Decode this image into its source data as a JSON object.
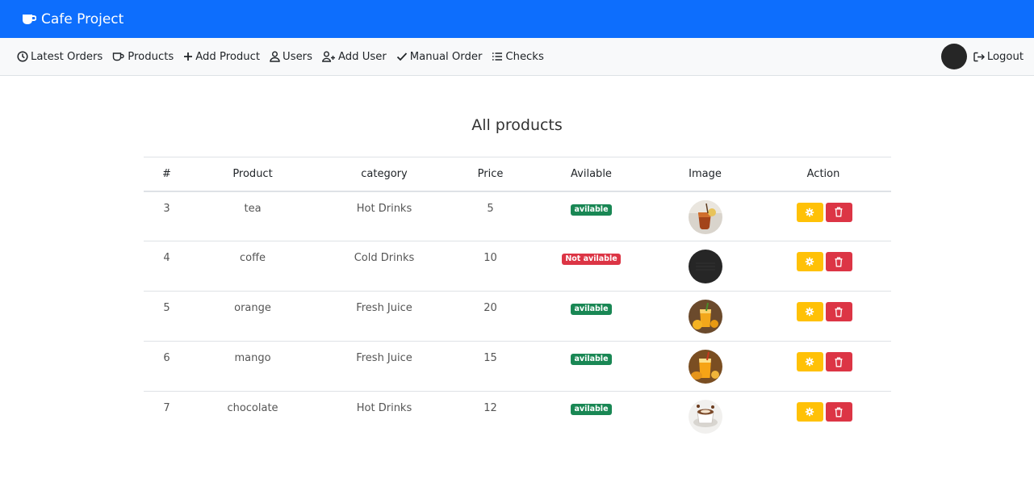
{
  "app": {
    "title": "Cafe Project"
  },
  "nav": {
    "links": [
      {
        "label": "Latest Orders",
        "icon": "clock-icon"
      },
      {
        "label": "Products",
        "icon": "cup-icon"
      },
      {
        "label": "Add Product",
        "icon": "plus-icon"
      },
      {
        "label": "Users",
        "icon": "user-icon"
      },
      {
        "label": "Add User",
        "icon": "user-plus-icon"
      },
      {
        "label": "Manual Order",
        "icon": "check-icon"
      },
      {
        "label": "Checks",
        "icon": "list-icon"
      }
    ],
    "logout_label": "Logout"
  },
  "page": {
    "title": "All products"
  },
  "table": {
    "headers": [
      "#",
      "Product",
      "category",
      "Price",
      "Avilable",
      "Image",
      "Action"
    ],
    "rows": [
      {
        "id": "3",
        "product": "tea",
        "category": "Hot Drinks",
        "price": "5",
        "status": "avilable",
        "available": true,
        "image": "tea-image"
      },
      {
        "id": "4",
        "product": "coffe",
        "category": "Cold Drinks",
        "price": "10",
        "status": "Not avilable",
        "available": false,
        "image": "coffee-image"
      },
      {
        "id": "5",
        "product": "orange",
        "category": "Fresh Juice",
        "price": "20",
        "status": "avilable",
        "available": true,
        "image": "orange-juice-image"
      },
      {
        "id": "6",
        "product": "mango",
        "category": "Fresh Juice",
        "price": "15",
        "status": "avilable",
        "available": true,
        "image": "mango-juice-image"
      },
      {
        "id": "7",
        "product": "chocolate",
        "category": "Hot Drinks",
        "price": "12",
        "status": "avilable",
        "available": true,
        "image": "hot-chocolate-image"
      }
    ]
  },
  "colors": {
    "primary": "#0d6efd",
    "success": "#198754",
    "danger": "#dc3545",
    "warning": "#ffc107",
    "navbar_bg": "#f8f9fa"
  }
}
